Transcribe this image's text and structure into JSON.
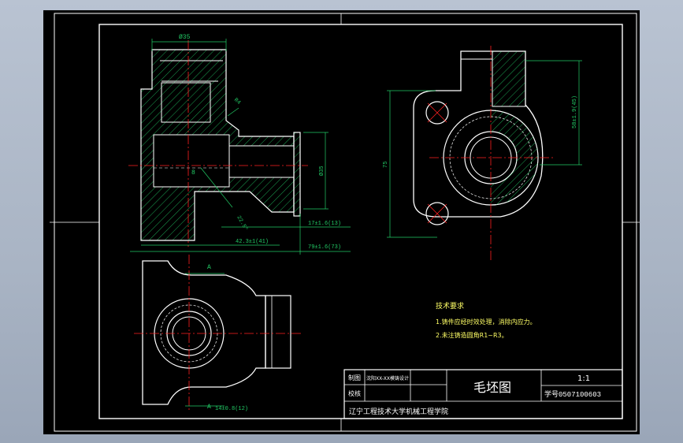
{
  "colors": {
    "background": "#000000",
    "frame": "#ffffff",
    "part": "#ffffff",
    "centerline": "#ff2020",
    "hatch": "#22cc66",
    "dimension": "#22cc66",
    "text_notes": "#ffff66",
    "title_text": "#ffffff"
  },
  "drawing": {
    "dims": {
      "top_width": "Ø35",
      "chamfer": "R4",
      "bore_dia": "Ø35",
      "wall": "8",
      "angle": "22.5°",
      "offset_17": "17±1.6(13)",
      "offset_42": "42.3±1(41)",
      "length_79": "79±1.6(73)",
      "height_75": "75",
      "side_height": "58±1.9(45)",
      "bottom_14": "14±0.8(12)",
      "section_mark_top": "A",
      "section_mark_bottom": "A"
    },
    "notes": {
      "title": "技术要求",
      "line1": "1.铸件应经时效处理，消除内应力。",
      "line2": "2.未注铸造圆角R1~R3。"
    }
  },
  "title_block": {
    "drawn_label": "制图",
    "check_label": "校核",
    "drawn_value": "沈阳XX-XX模铸设计",
    "drawing_name": "毛坯图",
    "scale": "1:1",
    "student_id": "学号0507100603",
    "school": "辽宁工程技术大学机械工程学院"
  }
}
